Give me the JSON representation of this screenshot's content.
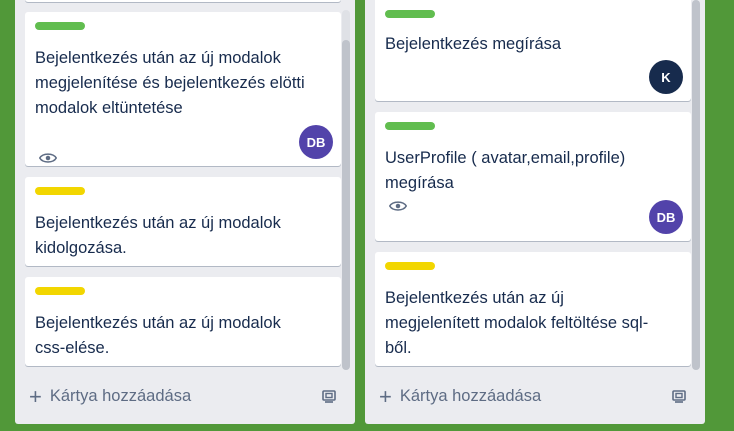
{
  "lists": [
    {
      "cards": [
        {
          "label_color": "#61bd4f",
          "title": "Bejelentkezés után az új modalok\nmegjelenítése és bejelentkezés elötti\nmodalok eltüntetése",
          "watched": true,
          "member": "DB",
          "member_color": "#5243aa"
        },
        {
          "label_color": "#f2d600",
          "title": "Bejelentkezés után az új modalok\nkidolgozása."
        },
        {
          "label_color": "#f2d600",
          "title": "Bejelentkezés után az új modalok\ncss-elése."
        }
      ],
      "add_card_label": "Kártya hozzáadása"
    },
    {
      "cards": [
        {
          "label_color": "#61bd4f",
          "title": "Bejelentkezés megírása",
          "member": "K",
          "member_color": "#172b4d"
        },
        {
          "label_color": "#61bd4f",
          "title": "UserProfile ( avatar,email,profile)\nmegírása",
          "watched": true,
          "member": "DB",
          "member_color": "#5243aa"
        },
        {
          "label_color": "#f2d600",
          "title": "Bejelentkezés után az új\nmegjelenített modalok feltöltése sql-\nből."
        }
      ],
      "add_card_label": "Kártya hozzáadása"
    }
  ]
}
